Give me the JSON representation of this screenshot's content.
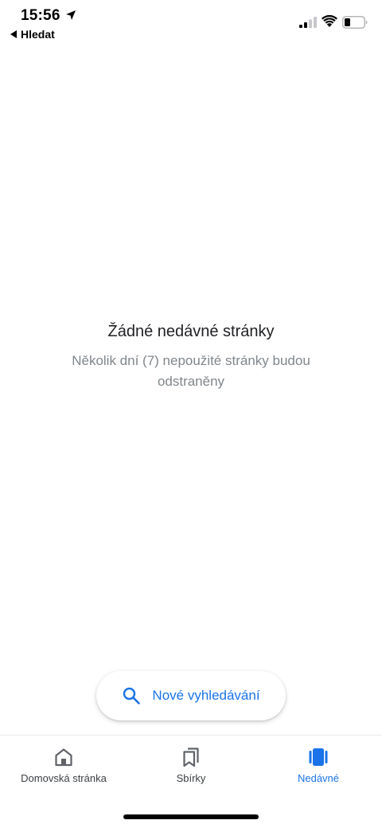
{
  "status_bar": {
    "time": "15:56",
    "back_label": "Hledat"
  },
  "empty_state": {
    "title": "Žádné nedávné stránky",
    "description": "Několik dní (7) nepoužité stránky budou odstraněny"
  },
  "new_search": {
    "label": "Nové vyhledávání",
    "icon": "search-icon"
  },
  "bottom_nav": {
    "items": [
      {
        "label": "Domovská stránka",
        "icon": "home-icon",
        "active": false
      },
      {
        "label": "Sbírky",
        "icon": "collections-icon",
        "active": false
      },
      {
        "label": "Nedávné",
        "icon": "recent-tabs-icon",
        "active": true
      }
    ]
  },
  "colors": {
    "accent": "#1a73e8",
    "text_primary": "#202124",
    "text_secondary": "#80868b",
    "icon_inactive": "#5f6368"
  }
}
